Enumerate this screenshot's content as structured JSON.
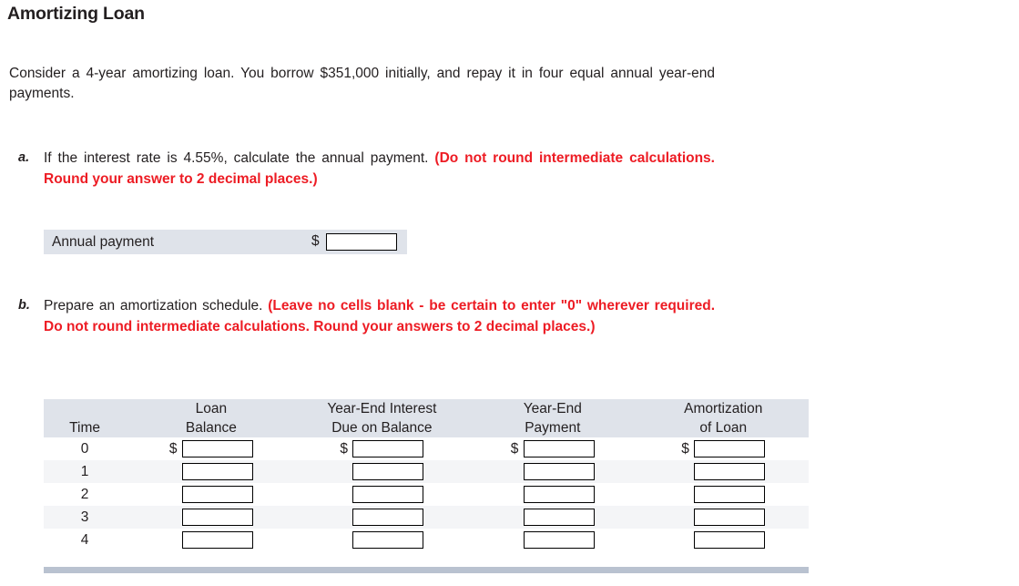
{
  "title": "Amortizing Loan",
  "intro": "Consider a 4-year amortizing loan. You borrow $351,000 initially, and repay it in four equal annual year-end payments.",
  "parts": {
    "a": {
      "marker": "a.",
      "question": "If the interest rate is 4.55%, calculate the annual payment. ",
      "instruction": "(Do not round intermediate calculations. Round your answer to 2 decimal places.)"
    },
    "b": {
      "marker": "b.",
      "question": "Prepare an amortization schedule. ",
      "instruction": "(Leave no cells blank - be certain to enter \"0\" wherever required. Do not round intermediate calculations. Round your answers to 2 decimal places.)"
    }
  },
  "annual_payment": {
    "label": "Annual payment",
    "currency": "$",
    "value": "",
    "placeholder": ""
  },
  "schedule": {
    "headers": [
      {
        "line1": "",
        "line2": "Time"
      },
      {
        "line1": "Loan",
        "line2": "Balance"
      },
      {
        "line1": "Year-End Interest",
        "line2": "Due on Balance"
      },
      {
        "line1": "Year-End",
        "line2": "Payment"
      },
      {
        "line1": "Amortization",
        "line2": "of Loan"
      }
    ],
    "currency": "$",
    "rows": [
      {
        "time": "0",
        "show_currency": true,
        "loan_balance": "",
        "interest_due": "",
        "payment": "",
        "amortization": ""
      },
      {
        "time": "1",
        "show_currency": false,
        "loan_balance": "",
        "interest_due": "",
        "payment": "",
        "amortization": ""
      },
      {
        "time": "2",
        "show_currency": false,
        "loan_balance": "",
        "interest_due": "",
        "payment": "",
        "amortization": ""
      },
      {
        "time": "3",
        "show_currency": false,
        "loan_balance": "",
        "interest_due": "",
        "payment": "",
        "amortization": ""
      },
      {
        "time": "4",
        "show_currency": false,
        "loan_balance": "",
        "interest_due": "",
        "payment": "",
        "amortization": ""
      }
    ]
  },
  "colors": {
    "header_fill": "#dfe3ea",
    "row_shade": "#f4f5f7",
    "accent_red": "#ed1c24",
    "footer_bar": "#b9c2d0"
  }
}
